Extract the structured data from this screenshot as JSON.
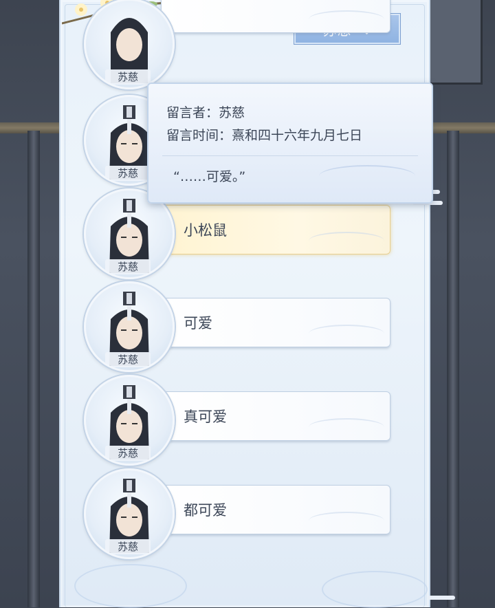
{
  "header": {
    "selected_name": "苏慈"
  },
  "tooltip": {
    "author_label": "留言者：",
    "author": "苏慈",
    "time_label": "留言时间：",
    "time": "熹和四十六年九月七日",
    "quote": "“……可爱。”"
  },
  "messages": [
    {
      "name": "苏慈",
      "text": ""
    },
    {
      "name": "苏慈",
      "text": ""
    },
    {
      "name": "苏慈",
      "text": "小松鼠",
      "selected": true
    },
    {
      "name": "苏慈",
      "text": "可爱"
    },
    {
      "name": "苏慈",
      "text": "真可爱"
    },
    {
      "name": "苏慈",
      "text": "都可爱"
    }
  ],
  "colors": {
    "panel": "#e8f1fa",
    "selected_bubble": "#fff4d2",
    "dropdown": "#9ebde6"
  }
}
